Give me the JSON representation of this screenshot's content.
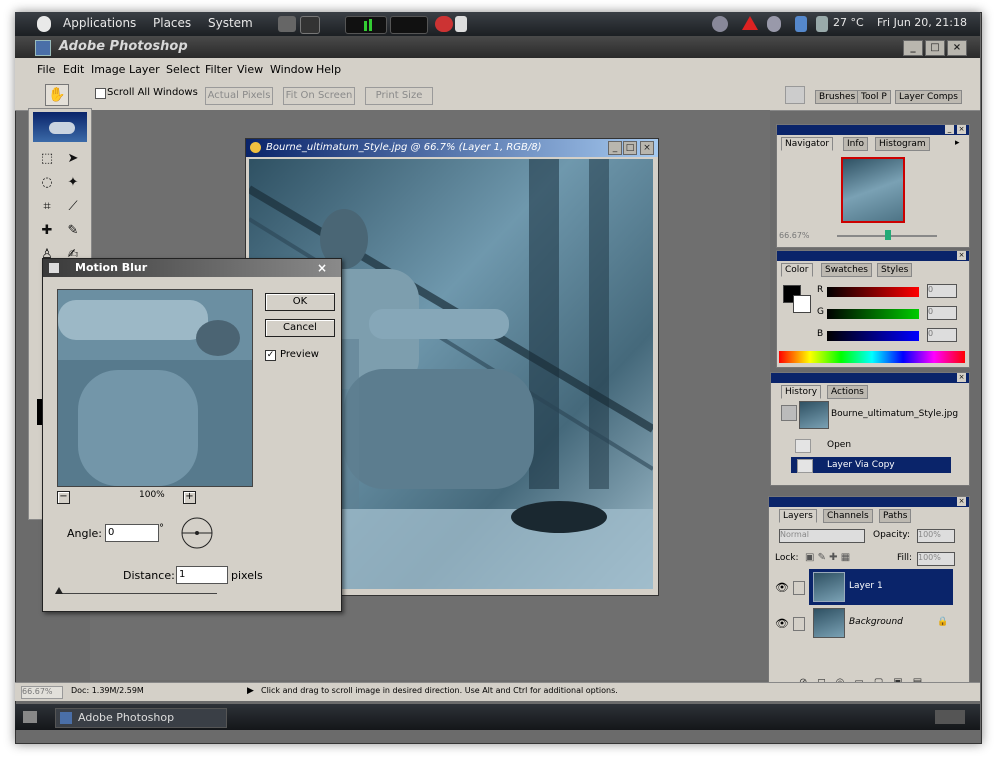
{
  "panel": {
    "menus": [
      "Applications",
      "Places",
      "System"
    ],
    "weather": "27 °C",
    "clock": "Fri Jun 20, 21:18"
  },
  "window": {
    "title": "Adobe Photoshop"
  },
  "menubar": [
    "File",
    "Edit",
    "Image",
    "Layer",
    "Select",
    "Filter",
    "View",
    "Window",
    "Help"
  ],
  "options": {
    "scroll_all": "Scroll All Windows",
    "actual_pixels": "Actual Pixels",
    "fit_on_screen": "Fit On Screen",
    "print_size": "Print Size",
    "well_tabs": [
      "Brushes",
      "Tool P",
      "Layer Comps"
    ]
  },
  "document": {
    "title": "Bourne_ultimatum_Style.jpg @ 66.7% (Layer 1, RGB/8)"
  },
  "dialog": {
    "title": "Motion Blur",
    "ok": "OK",
    "cancel": "Cancel",
    "preview": "Preview",
    "zoom": "100%",
    "angle_label": "Angle:",
    "angle_value": "0",
    "degree": "°",
    "distance_label": "Distance:",
    "distance_value": "1",
    "pixels": "pixels"
  },
  "navigator": {
    "tabs": [
      "Navigator",
      "Info",
      "Histogram"
    ],
    "zoom": "66.67%"
  },
  "color": {
    "tabs": [
      "Color",
      "Swatches",
      "Styles"
    ],
    "channels": [
      "R",
      "G",
      "B"
    ],
    "values": [
      "0",
      "0",
      "0"
    ]
  },
  "history": {
    "tabs": [
      "History",
      "Actions"
    ],
    "snapshot": "Bourne_ultimatum_Style.jpg",
    "items": [
      "Open",
      "Layer Via Copy"
    ]
  },
  "layers": {
    "tabs": [
      "Layers",
      "Channels",
      "Paths"
    ],
    "blend": "Normal",
    "opacity_label": "Opacity:",
    "opacity": "100%",
    "lock_label": "Lock:",
    "fill_label": "Fill:",
    "fill": "100%",
    "items": [
      "Layer 1",
      "Background"
    ]
  },
  "status": {
    "zoom": "66.67%",
    "doc": "Doc: 1.39M/2.59M",
    "message": "Click and drag to scroll image in desired direction.  Use Alt and Ctrl for additional options."
  },
  "taskbar": {
    "item": "Adobe Photoshop"
  },
  "colors": {
    "title_blue": "#0a246a",
    "chrome": "#d4d0c8",
    "workspace": "#6f6f6f"
  }
}
